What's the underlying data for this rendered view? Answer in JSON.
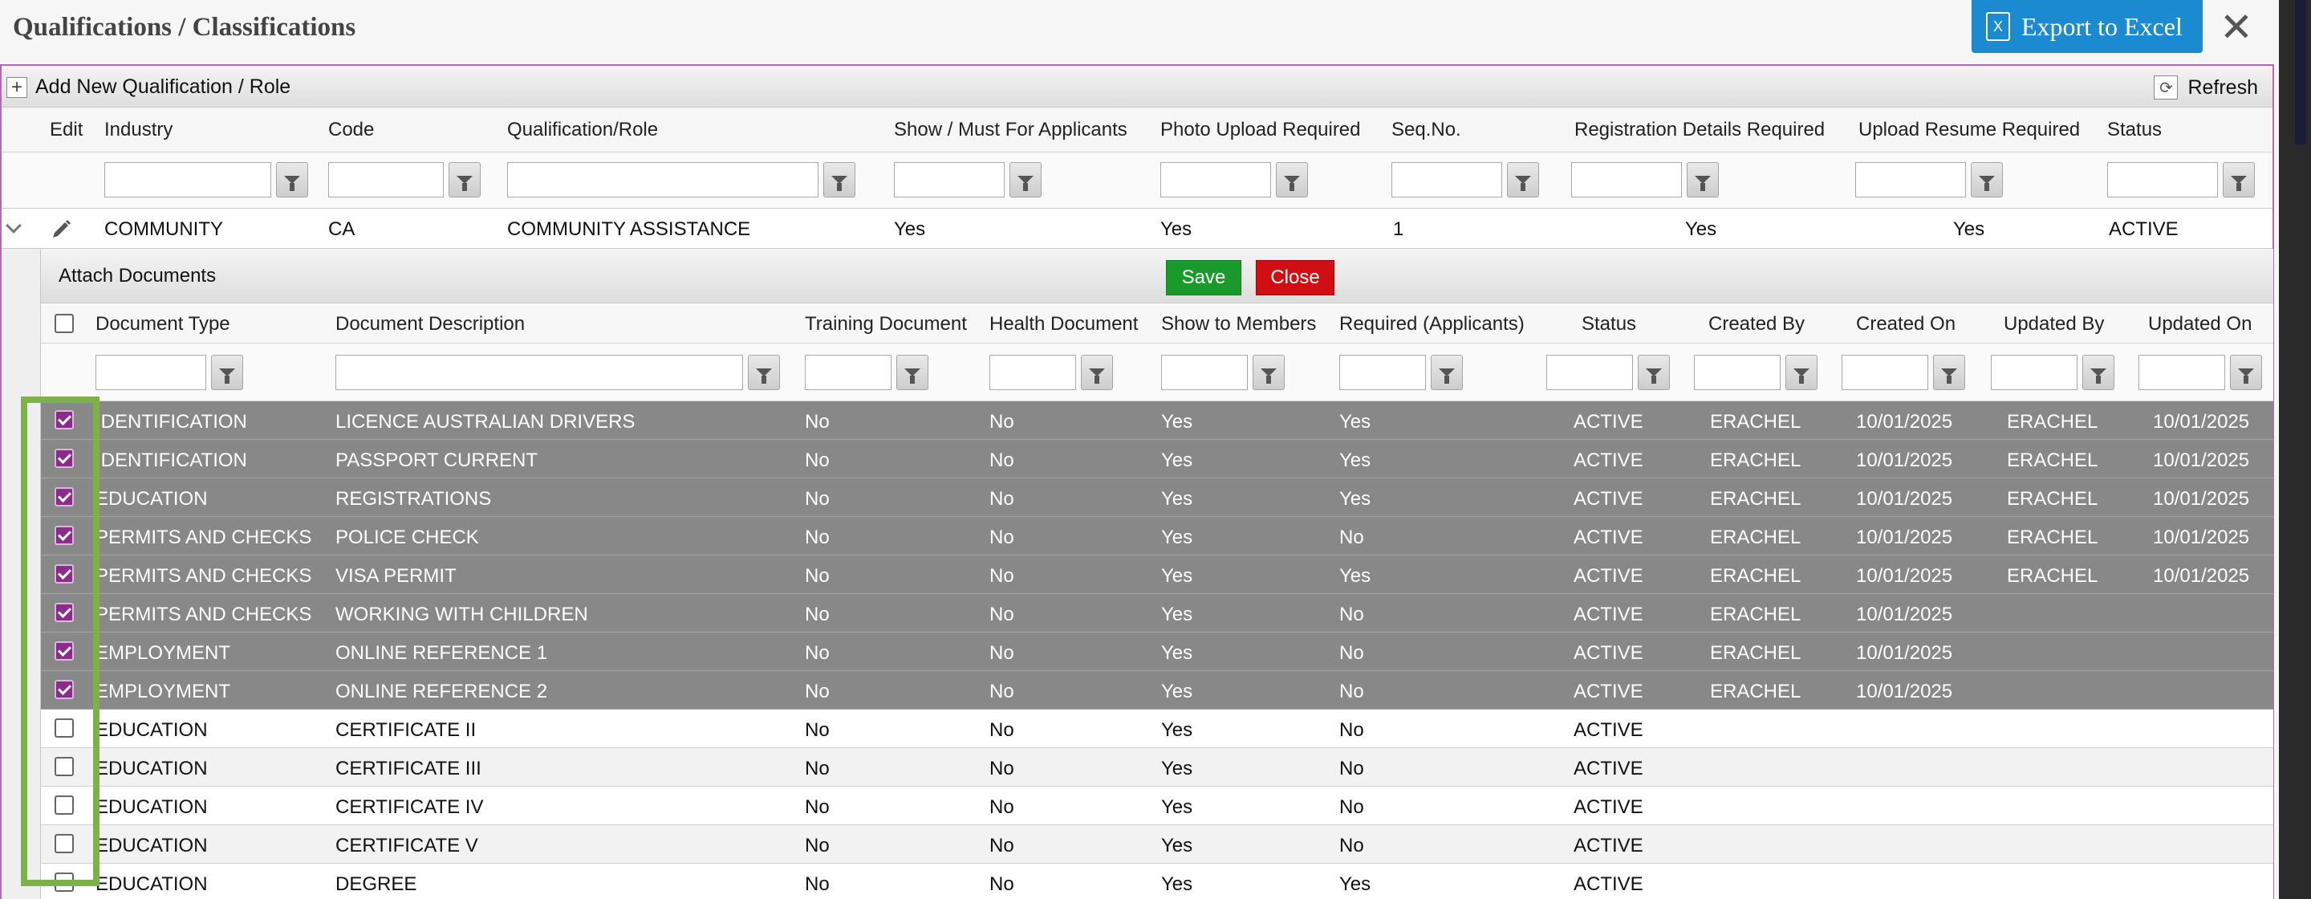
{
  "dialog": {
    "title": "Qualifications / Classifications",
    "export_label": "Export to Excel",
    "export_icon": "excel-icon",
    "close_symbol": "✕"
  },
  "toolbar": {
    "add_label": "Add New Qualification / Role",
    "refresh_label": "Refresh"
  },
  "columns": {
    "edit": "Edit",
    "industry": "Industry",
    "code": "Code",
    "qualification": "Qualification/Role",
    "show_must": "Show / Must For Applicants",
    "photo": "Photo Upload Required",
    "seq": "Seq.No.",
    "registration": "Registration Details Required",
    "resume": "Upload Resume Required",
    "status": "Status"
  },
  "main_row": {
    "industry": "COMMUNITY",
    "code": "CA",
    "qualification": "COMMUNITY ASSISTANCE",
    "show_must": "Yes",
    "photo": "Yes",
    "seq": "1",
    "registration": "Yes",
    "resume": "Yes",
    "status": "ACTIVE"
  },
  "sub_grid": {
    "title": "Attach Documents",
    "save_label": "Save",
    "close_label": "Close",
    "columns": {
      "doc_type": "Document Type",
      "doc_desc": "Document Description",
      "training": "Training Document",
      "health": "Health Document",
      "show_members": "Show to Members",
      "required": "Required (Applicants)",
      "status": "Status",
      "created_by": "Created By",
      "created_on": "Created On",
      "updated_by": "Updated By",
      "updated_on": "Updated On"
    },
    "rows": [
      {
        "checked": true,
        "type": "IDENTIFICATION",
        "desc": "LICENCE AUSTRALIAN DRIVERS",
        "training": "No",
        "health": "No",
        "show": "Yes",
        "required": "Yes",
        "status": "ACTIVE",
        "created_by": "ERACHEL",
        "created_on": "10/01/2025",
        "updated_by": "ERACHEL",
        "updated_on": "10/01/2025"
      },
      {
        "checked": true,
        "type": "IDENTIFICATION",
        "desc": "PASSPORT CURRENT",
        "training": "No",
        "health": "No",
        "show": "Yes",
        "required": "Yes",
        "status": "ACTIVE",
        "created_by": "ERACHEL",
        "created_on": "10/01/2025",
        "updated_by": "ERACHEL",
        "updated_on": "10/01/2025"
      },
      {
        "checked": true,
        "type": "EDUCATION",
        "desc": "REGISTRATIONS",
        "training": "No",
        "health": "No",
        "show": "Yes",
        "required": "Yes",
        "status": "ACTIVE",
        "created_by": "ERACHEL",
        "created_on": "10/01/2025",
        "updated_by": "ERACHEL",
        "updated_on": "10/01/2025"
      },
      {
        "checked": true,
        "type": "PERMITS AND CHECKS",
        "desc": "POLICE CHECK",
        "training": "No",
        "health": "No",
        "show": "Yes",
        "required": "No",
        "status": "ACTIVE",
        "created_by": "ERACHEL",
        "created_on": "10/01/2025",
        "updated_by": "ERACHEL",
        "updated_on": "10/01/2025"
      },
      {
        "checked": true,
        "type": "PERMITS AND CHECKS",
        "desc": "VISA PERMIT",
        "training": "No",
        "health": "No",
        "show": "Yes",
        "required": "Yes",
        "status": "ACTIVE",
        "created_by": "ERACHEL",
        "created_on": "10/01/2025",
        "updated_by": "ERACHEL",
        "updated_on": "10/01/2025"
      },
      {
        "checked": true,
        "type": "PERMITS AND CHECKS",
        "desc": "WORKING WITH CHILDREN",
        "training": "No",
        "health": "No",
        "show": "Yes",
        "required": "No",
        "status": "ACTIVE",
        "created_by": "ERACHEL",
        "created_on": "10/01/2025",
        "updated_by": "",
        "updated_on": ""
      },
      {
        "checked": true,
        "type": "EMPLOYMENT",
        "desc": "ONLINE REFERENCE 1",
        "training": "No",
        "health": "No",
        "show": "Yes",
        "required": "No",
        "status": "ACTIVE",
        "created_by": "ERACHEL",
        "created_on": "10/01/2025",
        "updated_by": "",
        "updated_on": ""
      },
      {
        "checked": true,
        "type": "EMPLOYMENT",
        "desc": "ONLINE REFERENCE 2",
        "training": "No",
        "health": "No",
        "show": "Yes",
        "required": "No",
        "status": "ACTIVE",
        "created_by": "ERACHEL",
        "created_on": "10/01/2025",
        "updated_by": "",
        "updated_on": ""
      },
      {
        "checked": false,
        "type": "EDUCATION",
        "desc": "CERTIFICATE II",
        "training": "No",
        "health": "No",
        "show": "Yes",
        "required": "No",
        "status": "ACTIVE",
        "created_by": "",
        "created_on": "",
        "updated_by": "",
        "updated_on": ""
      },
      {
        "checked": false,
        "type": "EDUCATION",
        "desc": "CERTIFICATE III",
        "training": "No",
        "health": "No",
        "show": "Yes",
        "required": "No",
        "status": "ACTIVE",
        "created_by": "",
        "created_on": "",
        "updated_by": "",
        "updated_on": ""
      },
      {
        "checked": false,
        "type": "EDUCATION",
        "desc": "CERTIFICATE IV",
        "training": "No",
        "health": "No",
        "show": "Yes",
        "required": "No",
        "status": "ACTIVE",
        "created_by": "",
        "created_on": "",
        "updated_by": "",
        "updated_on": ""
      },
      {
        "checked": false,
        "type": "EDUCATION",
        "desc": "CERTIFICATE V",
        "training": "No",
        "health": "No",
        "show": "Yes",
        "required": "No",
        "status": "ACTIVE",
        "created_by": "",
        "created_on": "",
        "updated_by": "",
        "updated_on": ""
      },
      {
        "checked": false,
        "type": "EDUCATION",
        "desc": "DEGREE",
        "training": "No",
        "health": "No",
        "show": "Yes",
        "required": "Yes",
        "status": "ACTIVE",
        "created_by": "",
        "created_on": "",
        "updated_by": "",
        "updated_on": ""
      }
    ]
  },
  "colors": {
    "accent_purple": "#8a2d8a",
    "export_blue": "#1b8ad0",
    "save_green": "#1a9a2a",
    "close_red": "#d10f12",
    "highlight_frame": "#7db24a",
    "selected_row": "#888888"
  }
}
